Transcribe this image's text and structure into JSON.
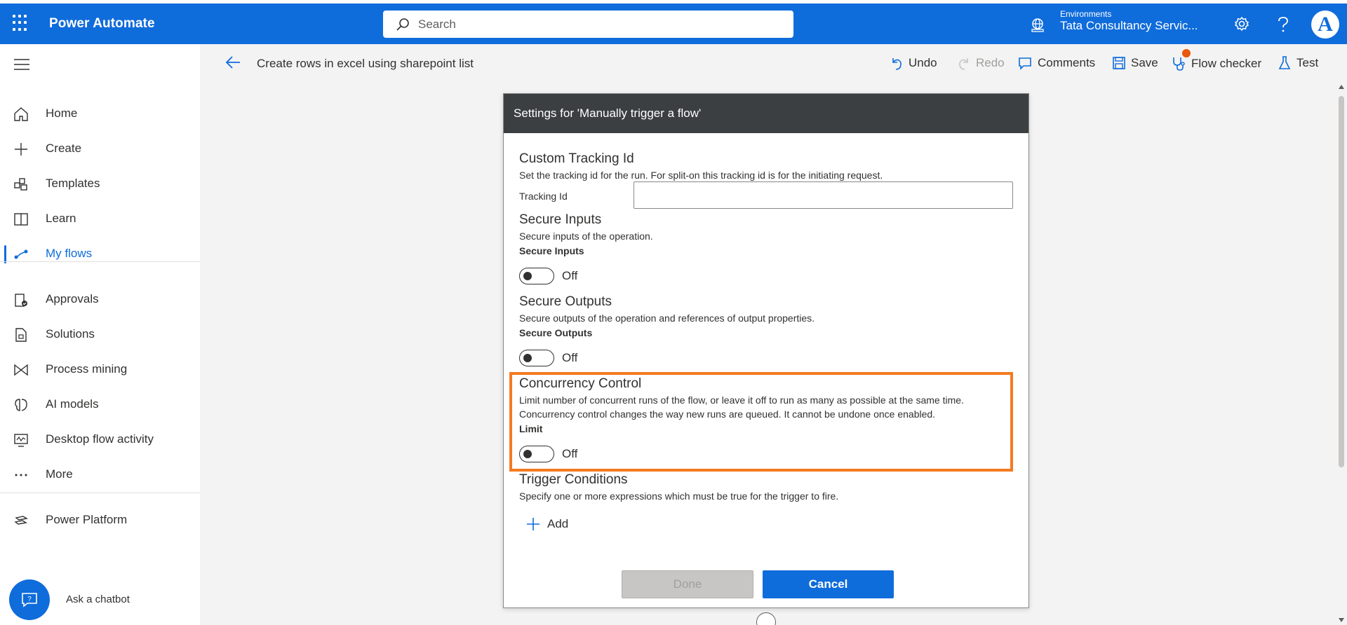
{
  "app": {
    "name": "Power Automate"
  },
  "search": {
    "placeholder": "Search"
  },
  "environment": {
    "label": "Environments",
    "name": "Tata Consultancy Servic..."
  },
  "user": {
    "avatar_letter": "A"
  },
  "sidebar": {
    "items": [
      {
        "label": "Home",
        "icon": "home-icon"
      },
      {
        "label": "Create",
        "icon": "plus-icon"
      },
      {
        "label": "Templates",
        "icon": "templates-icon"
      },
      {
        "label": "Learn",
        "icon": "book-icon"
      },
      {
        "label": "My flows",
        "icon": "flows-icon",
        "active": true
      },
      {
        "label": "Approvals",
        "icon": "approvals-icon"
      },
      {
        "label": "Solutions",
        "icon": "solutions-icon"
      },
      {
        "label": "Process mining",
        "icon": "process-mining-icon"
      },
      {
        "label": "AI models",
        "icon": "ai-models-icon"
      },
      {
        "label": "Desktop flow activity",
        "icon": "desktop-flow-icon"
      },
      {
        "label": "More",
        "icon": "more-icon"
      },
      {
        "label": "Power Platform",
        "icon": "power-platform-icon"
      }
    ],
    "chatbot_label": "Ask a chatbot"
  },
  "commandbar": {
    "flow_name": "Create rows in excel using sharepoint list",
    "undo": "Undo",
    "redo": "Redo",
    "comments": "Comments",
    "save": "Save",
    "flow_checker": "Flow checker",
    "test": "Test"
  },
  "dialog": {
    "title": "Settings for 'Manually trigger a flow'",
    "tracking": {
      "title": "Custom Tracking Id",
      "desc": "Set the tracking id for the run. For split-on this tracking id is for the initiating request.",
      "field_label": "Tracking Id",
      "value": ""
    },
    "secure_inputs": {
      "title": "Secure Inputs",
      "desc": "Secure inputs of the operation.",
      "label": "Secure Inputs",
      "state": "Off"
    },
    "secure_outputs": {
      "title": "Secure Outputs",
      "desc": "Secure outputs of the operation and references of output properties.",
      "label": "Secure Outputs",
      "state": "Off"
    },
    "concurrency": {
      "title": "Concurrency Control",
      "desc1": "Limit number of concurrent runs of the flow, or leave it off to run as many as possible at the same time.",
      "desc2": "Concurrency control changes the way new runs are queued. It cannot be undone once enabled.",
      "label": "Limit",
      "state": "Off"
    },
    "trigger_conditions": {
      "title": "Trigger Conditions",
      "desc": "Specify one or more expressions which must be true for the trigger to fire.",
      "add": "Add"
    },
    "done": "Done",
    "cancel": "Cancel"
  },
  "colors": {
    "brand": "#0f6cdb",
    "highlight": "#f47a20",
    "header": "#3b3f42"
  }
}
